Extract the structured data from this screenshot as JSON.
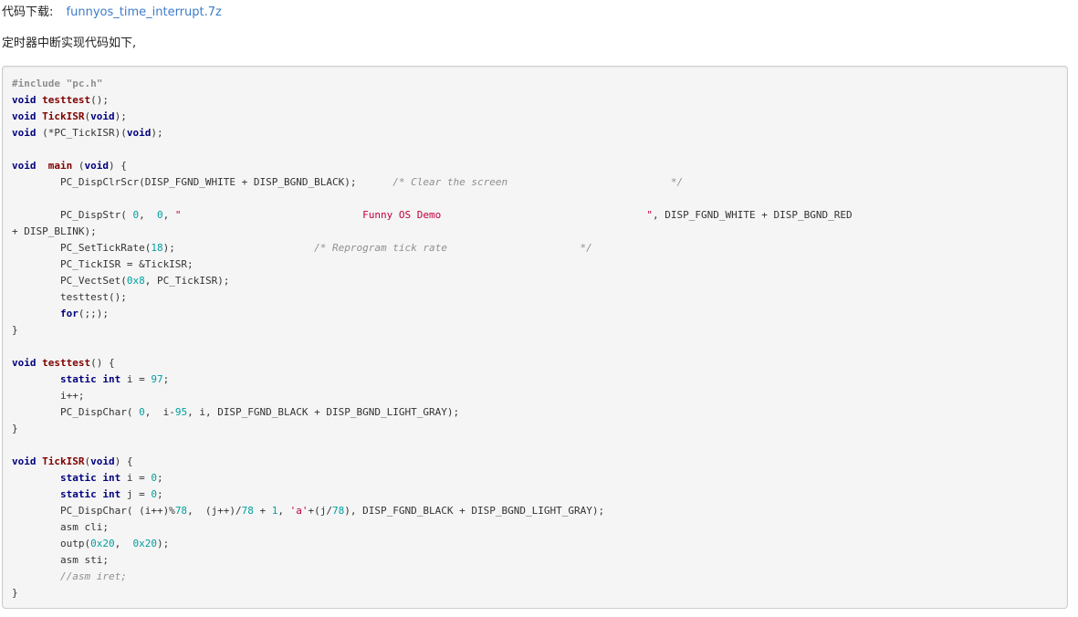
{
  "download": {
    "label": "代码下载:",
    "link_text": "funnyos_time_interrupt.7z"
  },
  "intro": "定时器中断实现代码如下,",
  "code": {
    "lines": [
      [
        {
          "t": "#include \"pc.h\"",
          "k": "pp"
        }
      ],
      [
        {
          "t": "void",
          "k": "kw"
        },
        {
          "t": " ",
          "k": "plain"
        },
        {
          "t": "testtest",
          "k": "fn"
        },
        {
          "t": "();",
          "k": "plain"
        }
      ],
      [
        {
          "t": "void",
          "k": "kw"
        },
        {
          "t": " ",
          "k": "plain"
        },
        {
          "t": "TickISR",
          "k": "fn"
        },
        {
          "t": "(",
          "k": "plain"
        },
        {
          "t": "void",
          "k": "kw"
        },
        {
          "t": ");",
          "k": "plain"
        }
      ],
      [
        {
          "t": "void",
          "k": "kw"
        },
        {
          "t": " (*PC_TickISR)(",
          "k": "plain"
        },
        {
          "t": "void",
          "k": "kw"
        },
        {
          "t": ");",
          "k": "plain"
        }
      ],
      [],
      [
        {
          "t": "void",
          "k": "kw"
        },
        {
          "t": "  ",
          "k": "plain"
        },
        {
          "t": "main",
          "k": "fn"
        },
        {
          "t": " (",
          "k": "plain"
        },
        {
          "t": "void",
          "k": "kw"
        },
        {
          "t": ") {",
          "k": "plain"
        }
      ],
      [
        {
          "t": "        PC_DispClrScr(DISP_FGND_WHITE + DISP_BGND_BLACK);      ",
          "k": "plain"
        },
        {
          "t": "/* Clear the screen                           */",
          "k": "cmt"
        }
      ],
      [],
      [
        {
          "t": "        PC_DispStr( ",
          "k": "plain"
        },
        {
          "t": "0",
          "k": "num"
        },
        {
          "t": ",  ",
          "k": "plain"
        },
        {
          "t": "0",
          "k": "num"
        },
        {
          "t": ", ",
          "k": "plain"
        },
        {
          "t": "\"                              Funny OS Demo                                  \"",
          "k": "str"
        },
        {
          "t": ", DISP_FGND_WHITE + DISP_BGND_RED",
          "k": "plain"
        }
      ],
      [
        {
          "t": "+ DISP_BLINK);",
          "k": "plain"
        }
      ],
      [
        {
          "t": "        PC_SetTickRate(",
          "k": "plain"
        },
        {
          "t": "18",
          "k": "num"
        },
        {
          "t": ");                       ",
          "k": "plain"
        },
        {
          "t": "/* Reprogram tick rate                      */",
          "k": "cmt"
        }
      ],
      [
        {
          "t": "        PC_TickISR = &TickISR;",
          "k": "plain"
        }
      ],
      [
        {
          "t": "        PC_VectSet(",
          "k": "plain"
        },
        {
          "t": "0x8",
          "k": "num"
        },
        {
          "t": ", PC_TickISR);",
          "k": "plain"
        }
      ],
      [
        {
          "t": "        testtest();",
          "k": "plain"
        }
      ],
      [
        {
          "t": "        ",
          "k": "plain"
        },
        {
          "t": "for",
          "k": "kw"
        },
        {
          "t": "(;;);",
          "k": "plain"
        }
      ],
      [
        {
          "t": "}",
          "k": "plain"
        }
      ],
      [],
      [
        {
          "t": "void",
          "k": "kw"
        },
        {
          "t": " ",
          "k": "plain"
        },
        {
          "t": "testtest",
          "k": "fn"
        },
        {
          "t": "() {",
          "k": "plain"
        }
      ],
      [
        {
          "t": "        ",
          "k": "plain"
        },
        {
          "t": "static",
          "k": "kw"
        },
        {
          "t": " ",
          "k": "plain"
        },
        {
          "t": "int",
          "k": "kw"
        },
        {
          "t": " i = ",
          "k": "plain"
        },
        {
          "t": "97",
          "k": "num"
        },
        {
          "t": ";",
          "k": "plain"
        }
      ],
      [
        {
          "t": "        i++;",
          "k": "plain"
        }
      ],
      [
        {
          "t": "        PC_DispChar( ",
          "k": "plain"
        },
        {
          "t": "0",
          "k": "num"
        },
        {
          "t": ",  i-",
          "k": "plain"
        },
        {
          "t": "95",
          "k": "num"
        },
        {
          "t": ", i, DISP_FGND_BLACK + DISP_BGND_LIGHT_GRAY);",
          "k": "plain"
        }
      ],
      [
        {
          "t": "}",
          "k": "plain"
        }
      ],
      [],
      [
        {
          "t": "void",
          "k": "kw"
        },
        {
          "t": " ",
          "k": "plain"
        },
        {
          "t": "TickISR",
          "k": "fn"
        },
        {
          "t": "(",
          "k": "plain"
        },
        {
          "t": "void",
          "k": "kw"
        },
        {
          "t": ") {",
          "k": "plain"
        }
      ],
      [
        {
          "t": "        ",
          "k": "plain"
        },
        {
          "t": "static",
          "k": "kw"
        },
        {
          "t": " ",
          "k": "plain"
        },
        {
          "t": "int",
          "k": "kw"
        },
        {
          "t": " i = ",
          "k": "plain"
        },
        {
          "t": "0",
          "k": "num"
        },
        {
          "t": ";",
          "k": "plain"
        }
      ],
      [
        {
          "t": "        ",
          "k": "plain"
        },
        {
          "t": "static",
          "k": "kw"
        },
        {
          "t": " ",
          "k": "plain"
        },
        {
          "t": "int",
          "k": "kw"
        },
        {
          "t": " j = ",
          "k": "plain"
        },
        {
          "t": "0",
          "k": "num"
        },
        {
          "t": ";",
          "k": "plain"
        }
      ],
      [
        {
          "t": "        PC_DispChar( (i++)%",
          "k": "plain"
        },
        {
          "t": "78",
          "k": "num"
        },
        {
          "t": ",  (j++)/",
          "k": "plain"
        },
        {
          "t": "78",
          "k": "num"
        },
        {
          "t": " + ",
          "k": "plain"
        },
        {
          "t": "1",
          "k": "num"
        },
        {
          "t": ", ",
          "k": "plain"
        },
        {
          "t": "'a'",
          "k": "str"
        },
        {
          "t": "+(j/",
          "k": "plain"
        },
        {
          "t": "78",
          "k": "num"
        },
        {
          "t": "), DISP_FGND_BLACK + DISP_BGND_LIGHT_GRAY);",
          "k": "plain"
        }
      ],
      [
        {
          "t": "        asm cli;",
          "k": "plain"
        }
      ],
      [
        {
          "t": "        outp(",
          "k": "plain"
        },
        {
          "t": "0x20",
          "k": "num"
        },
        {
          "t": ",  ",
          "k": "plain"
        },
        {
          "t": "0x20",
          "k": "num"
        },
        {
          "t": ");",
          "k": "plain"
        }
      ],
      [
        {
          "t": "        asm sti;",
          "k": "plain"
        }
      ],
      [
        {
          "t": "        ",
          "k": "plain"
        },
        {
          "t": "//asm iret;",
          "k": "cmt"
        }
      ],
      [
        {
          "t": "}",
          "k": "plain"
        }
      ]
    ]
  }
}
